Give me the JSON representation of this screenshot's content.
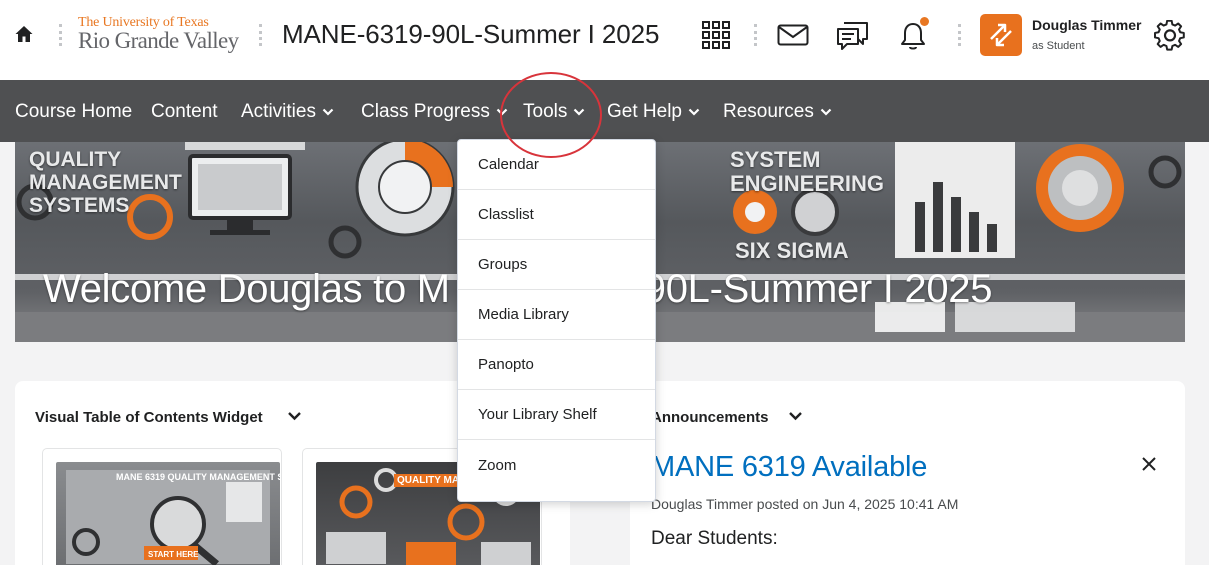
{
  "header": {
    "logo_line1": "The University of Texas",
    "logo_line2": "Rio Grande Valley",
    "course_title": "MANE-6319-90L-Summer I 2025",
    "user_name": "Douglas Timmer",
    "user_role": "as Student",
    "icons": [
      "home-icon",
      "apps-grid-icon",
      "mail-icon",
      "chat-icon",
      "bell-icon",
      "swap-arrows-icon",
      "gear-icon"
    ]
  },
  "nav": {
    "items": [
      {
        "label": "Course Home",
        "has_menu": false
      },
      {
        "label": "Content",
        "has_menu": false
      },
      {
        "label": "Activities",
        "has_menu": true
      },
      {
        "label": "Class Progress",
        "has_menu": true
      },
      {
        "label": "Tools",
        "has_menu": true,
        "open": true
      },
      {
        "label": "Get Help",
        "has_menu": true
      },
      {
        "label": "Resources",
        "has_menu": true
      }
    ]
  },
  "banner": {
    "welcome_text": "Welcome Douglas to MANE-6319-90L-Summer I 2025",
    "welcome_visible_left": "Welcome Douglas to M",
    "welcome_visible_right": "90L-Summer I 2025",
    "labels": [
      "QUALITY MANAGEMENT SYSTEMS",
      "SYSTEM ENGINEERING",
      "SIX SIGMA"
    ]
  },
  "tools_menu": {
    "items": [
      "Calendar",
      "Classlist",
      "Groups",
      "Media Library",
      "Panopto",
      "Your Library Shelf",
      "Zoom"
    ]
  },
  "toc_widget": {
    "title": "Visual Table of Contents Widget",
    "thumbnails": [
      {
        "caption": "MANE 6319 QUALITY MANAGEMENT SYSTEMS",
        "button": "START HERE"
      },
      {
        "caption": "QUALITY MANAGEMENT",
        "button": ""
      }
    ]
  },
  "announcements": {
    "title": "Announcements",
    "heading": "MANE 6319 Available",
    "meta": "Douglas Timmer posted on Jun 4, 2025 10:41 AM",
    "body_start": "Dear Students:"
  },
  "colors": {
    "brand_orange": "#e87722",
    "nav_bg": "#4f5052",
    "link_blue": "#006fbf",
    "highlight_red": "#d8343b",
    "avatar_bg": "#e8711e"
  }
}
